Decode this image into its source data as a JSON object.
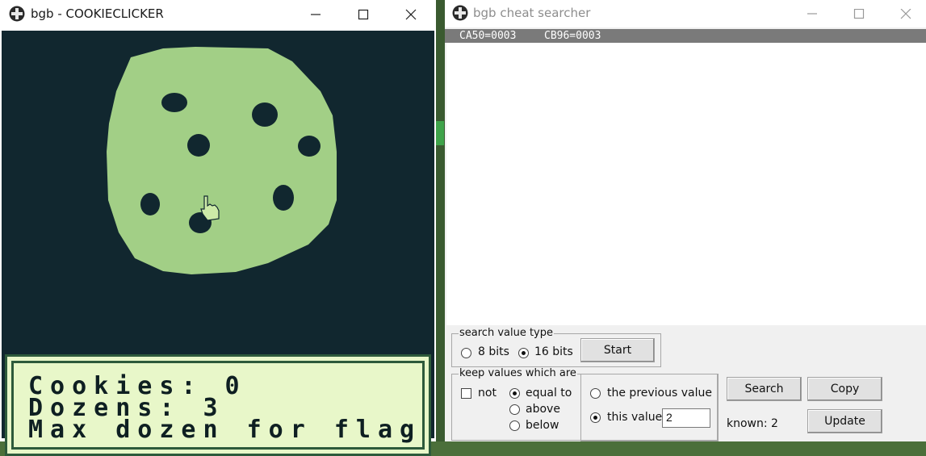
{
  "emulator": {
    "title": "bgb - COOKIECLICKER",
    "game_text": {
      "line1": "Cookies: 0",
      "line2": "Dozens: 3",
      "line3": "Max dozen for flag"
    }
  },
  "cheat": {
    "title": "bgb cheat searcher",
    "results": [
      "CA50=0003",
      "CB96=0003"
    ],
    "value_type": {
      "label": "search value type",
      "opt8": "8 bits",
      "opt16": "16 bits",
      "selected": "16 bits",
      "start_label": "Start"
    },
    "keep": {
      "label": "keep values which are",
      "not_label": "not",
      "equal_label": "equal to",
      "above_label": "above",
      "below_label": "below",
      "selected": "equal to",
      "previous_label": "the previous value",
      "this_value_label": "this value:",
      "this_value": "2",
      "compare_selected": "this value:"
    },
    "search_label": "Search",
    "copy_label": "Copy",
    "update_label": "Update",
    "known_text": "known: 2"
  },
  "colors": {
    "screen_bg": "#11272f",
    "cookie": "#a2cf86",
    "chip": "#11272f",
    "text_panel": "#e8f7c9",
    "border": "#2d5a3b"
  },
  "icons": {
    "app": "bgb-cross-icon",
    "cursor": "hand-pointer-icon"
  }
}
